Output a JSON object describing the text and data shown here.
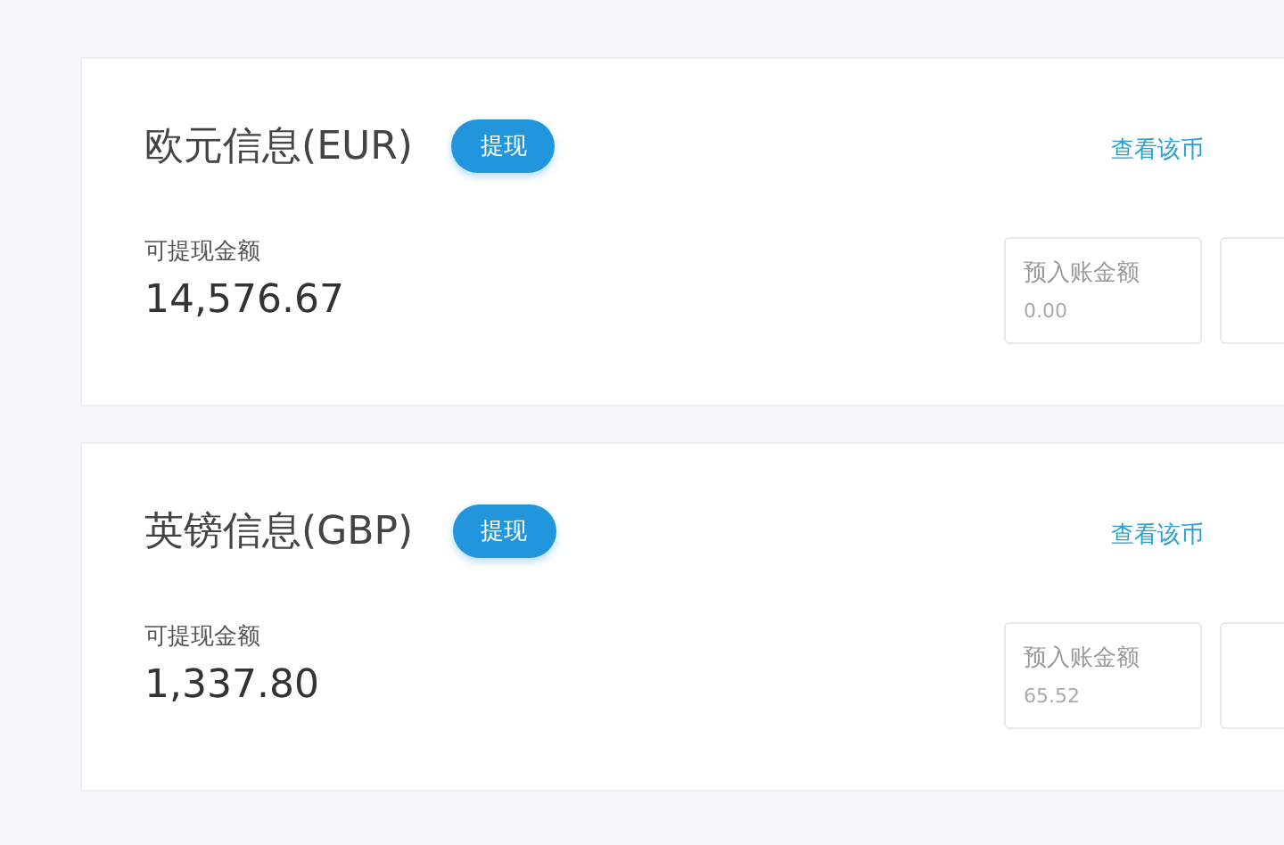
{
  "accounts": [
    {
      "title": "欧元信息(EUR)",
      "button": "提现",
      "link": "查看该币",
      "balance_label": "可提现金额",
      "balance": "14,576.67",
      "pending_label": "预入账金额",
      "pending": "0.00"
    },
    {
      "title": "英镑信息(GBP)",
      "button": "提现",
      "link": "查看该币",
      "balance_label": "可提现金额",
      "balance": "1,337.80",
      "pending_label": "预入账金额",
      "pending": "65.52"
    }
  ]
}
